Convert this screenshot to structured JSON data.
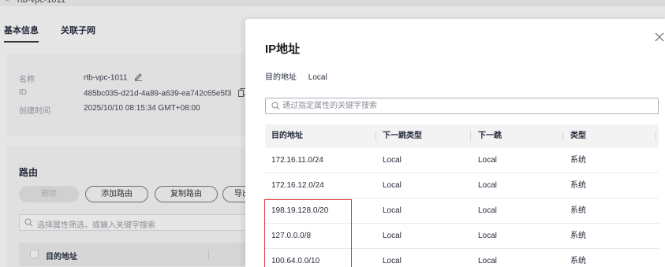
{
  "background": {
    "breadcrumb": "rtb-vpc-1011",
    "tabs": [
      "基本信息",
      "关联子网"
    ],
    "info": [
      {
        "label": "名称",
        "value": "rtb-vpc-1011"
      },
      {
        "label": "ID",
        "value": "485bc035-d21d-4a89-a639-ea742c65e5f3"
      },
      {
        "label": "创建时间",
        "value": "2025/10/10 08:15:34 GMT+08:00"
      }
    ],
    "route_section": {
      "title": "路由",
      "buttons": {
        "delete": "删除",
        "add": "添加路由",
        "copy": "复制路由",
        "export": "导出"
      },
      "search_placeholder": "选择属性筛选，或输入关键字搜索",
      "table_header": "目的地址"
    }
  },
  "drawer": {
    "title": "IP地址",
    "dest_label": "目的地址",
    "dest_value": "Local",
    "search_placeholder": "通过指定属性的关键字搜索",
    "columns": [
      "目的地址",
      "下一跳类型",
      "下一跳",
      "类型"
    ],
    "rows": [
      [
        "172.16.11.0/24",
        "Local",
        "Local",
        "系统"
      ],
      [
        "172.16.12.0/24",
        "Local",
        "Local",
        "系统"
      ],
      [
        "198.19.128.0/20",
        "Local",
        "Local",
        "系统"
      ],
      [
        "127.0.0.0/8",
        "Local",
        "Local",
        "系统"
      ],
      [
        "100.64.0.0/10",
        "Local",
        "Local",
        "系统"
      ]
    ]
  },
  "colors": {
    "highlight": "#e0393e",
    "header_bg": "#f3f3f3"
  }
}
